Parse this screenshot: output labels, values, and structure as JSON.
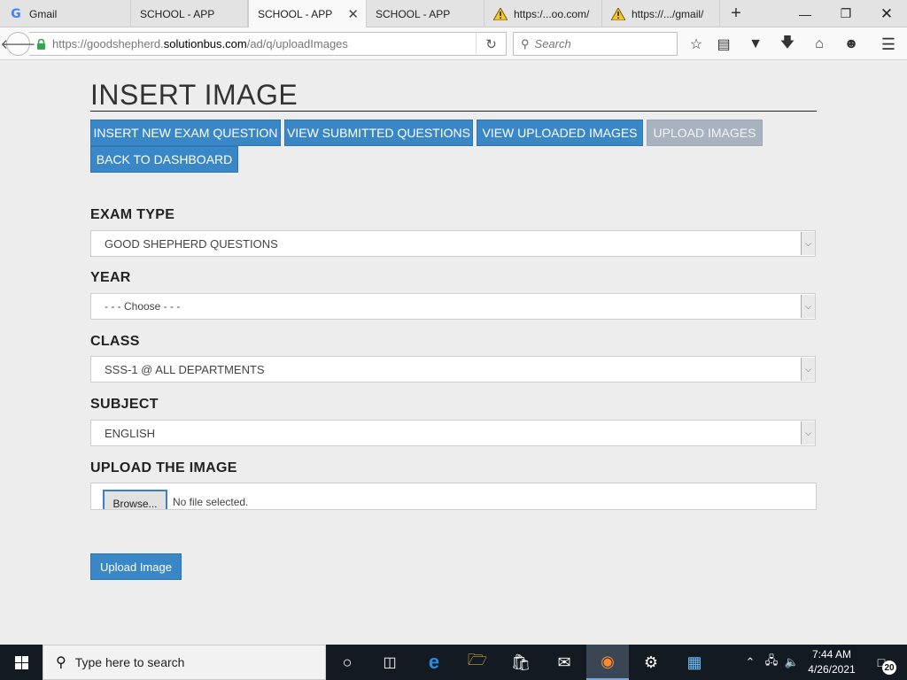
{
  "browser": {
    "tabs": [
      {
        "label": "Gmail",
        "icon": "google-icon",
        "active": false
      },
      {
        "label": "SCHOOL - APP",
        "icon": "",
        "active": false
      },
      {
        "label": "SCHOOL - APP",
        "icon": "",
        "active": true
      },
      {
        "label": "SCHOOL - APP",
        "icon": "",
        "active": false
      },
      {
        "label": "https:/...oo.com/",
        "icon": "warning-icon",
        "active": false
      },
      {
        "label": "https://.../gmail/",
        "icon": "warning-icon",
        "active": false
      }
    ],
    "url_prefix": "https://goodshepherd.",
    "url_host": "solutionbus.com",
    "url_path": "/ad/q/uploadImages",
    "search_placeholder": "Search"
  },
  "page": {
    "title": "INSERT IMAGE",
    "nav_buttons": [
      {
        "label": "INSERT NEW EXAM QUESTION",
        "enabled": true
      },
      {
        "label": "VIEW SUBMITTED QUESTIONS",
        "enabled": true
      },
      {
        "label": "VIEW UPLOADED IMAGES",
        "enabled": true
      },
      {
        "label": "UPLOAD IMAGES",
        "enabled": false
      },
      {
        "label": "BACK TO DASHBOARD",
        "enabled": true
      }
    ],
    "fields": {
      "exam_type": {
        "label": "EXAM TYPE",
        "value": "GOOD SHEPHERD QUESTIONS"
      },
      "year": {
        "label": "YEAR",
        "value": "- - - Choose - - -"
      },
      "class": {
        "label": "CLASS",
        "value": "SSS-1 @ ALL DEPARTMENTS"
      },
      "subject": {
        "label": "SUBJECT",
        "value": "ENGLISH"
      },
      "upload": {
        "label": "UPLOAD THE IMAGE",
        "browse_label": "Browse...",
        "status": "No file selected."
      }
    },
    "submit_label": "Upload Image"
  },
  "taskbar": {
    "search_placeholder": "Type here to search",
    "time": "7:44 AM",
    "date": "4/26/2021",
    "notification_count": "20"
  },
  "colors": {
    "primary_button": "#3a87c8",
    "disabled_button": "#a8b3bf",
    "page_background": "#ededed",
    "taskbar": "#141a22"
  }
}
